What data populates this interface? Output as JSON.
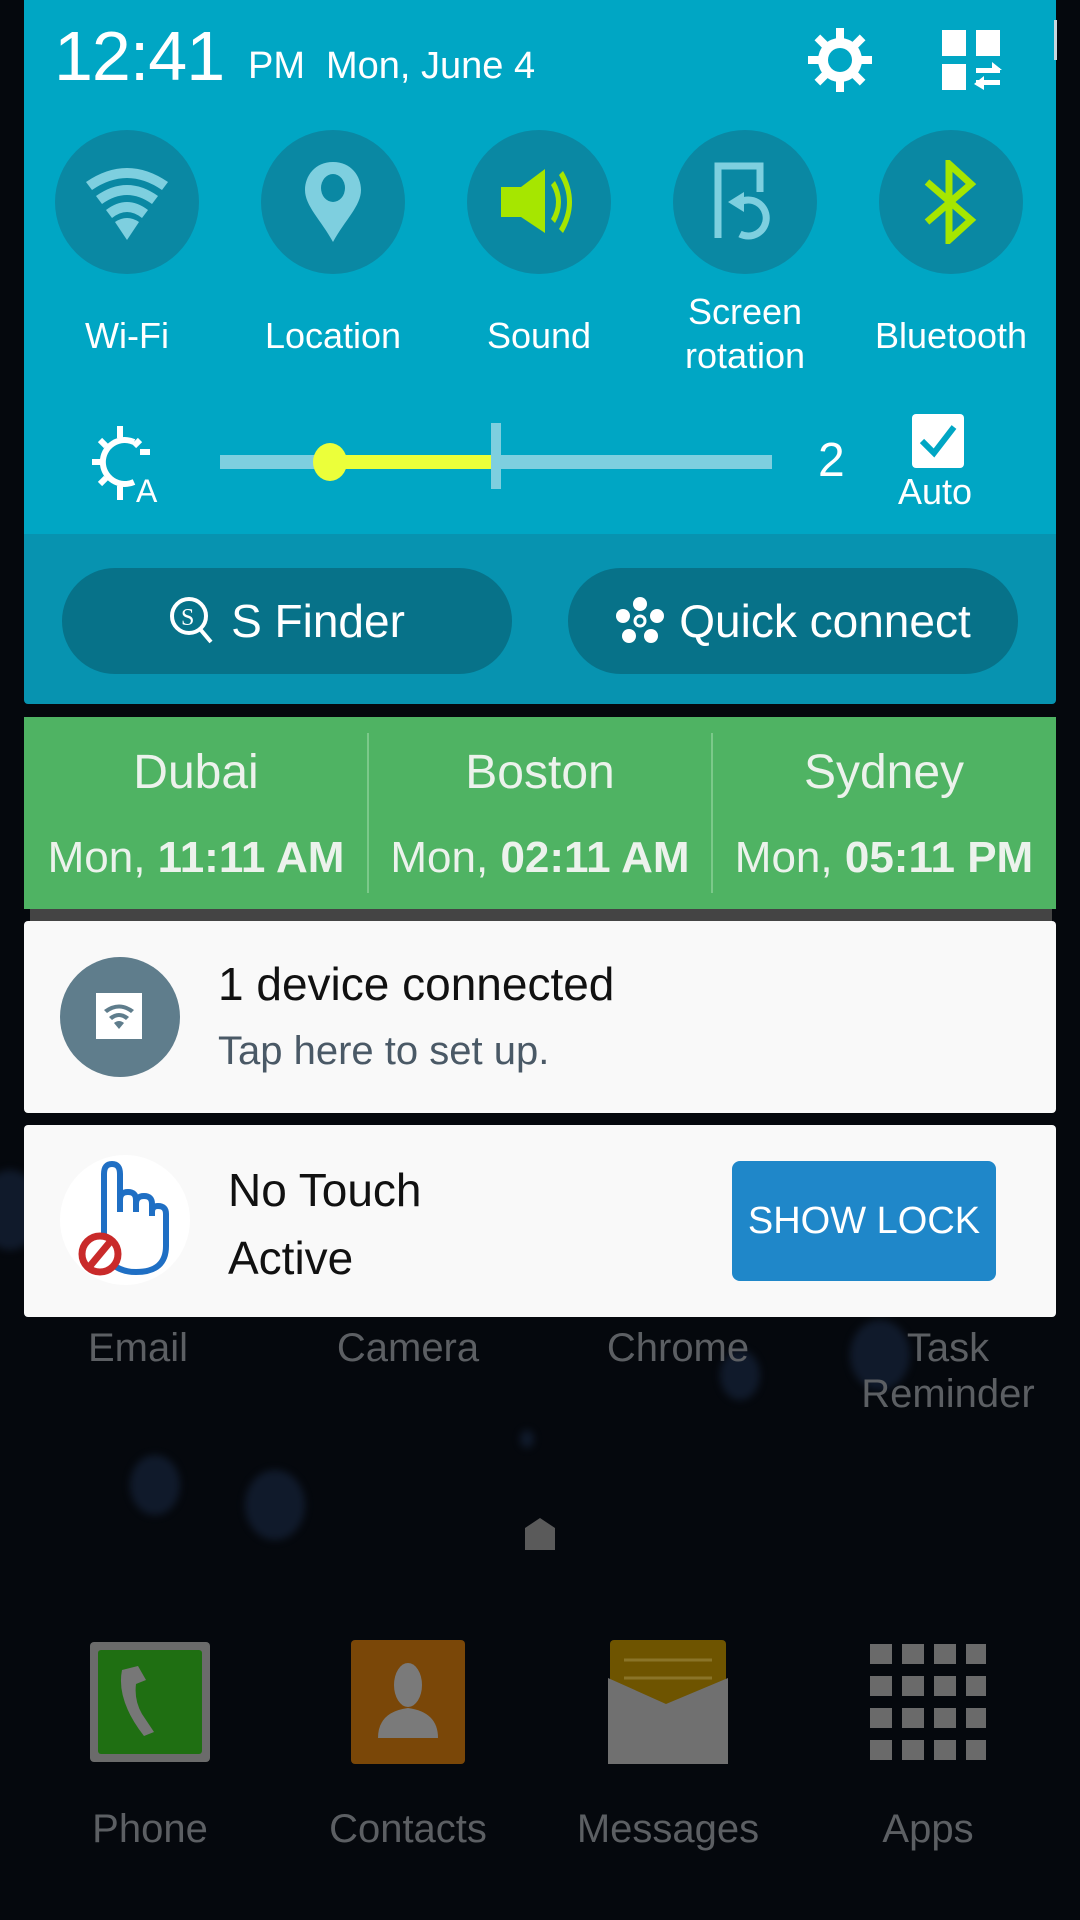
{
  "status": {
    "time": "12:41",
    "ampm": "PM",
    "date": "Mon, June 4"
  },
  "header_icons": {
    "settings": "gear-icon",
    "edit": "quick-panel-edit-icon"
  },
  "toggles": [
    {
      "label": "Wi-Fi",
      "icon": "wifi-icon",
      "active": false
    },
    {
      "label": "Location",
      "icon": "location-pin-icon",
      "active": false
    },
    {
      "label": "Sound",
      "icon": "speaker-icon",
      "active": true
    },
    {
      "label": "Screen rotation",
      "line1": "Screen",
      "line2": "rotation",
      "icon": "screen-rotation-icon",
      "active": false
    },
    {
      "label": "Bluetooth",
      "icon": "bluetooth-icon",
      "active": true
    }
  ],
  "brightness": {
    "icon": "auto-brightness-icon",
    "value": "2",
    "level_fraction": 0.2,
    "auto_level_fraction": 0.5,
    "auto_label": "Auto",
    "auto_checked": true
  },
  "quick_actions": [
    {
      "label": "S Finder",
      "icon": "s-finder-search-icon"
    },
    {
      "label": "Quick connect",
      "icon": "quick-connect-icon"
    }
  ],
  "world_clock": [
    {
      "city": "Dubai",
      "day": "Mon,",
      "time": "11:11 AM"
    },
    {
      "city": "Boston",
      "day": "Mon,",
      "time": "02:11 AM"
    },
    {
      "city": "Sydney",
      "day": "Mon,",
      "time": "05:11 PM"
    }
  ],
  "notifications": [
    {
      "title": "1 device connected",
      "subtitle": "Tap here to set up.",
      "icon": "wifi-device-icon"
    },
    {
      "title": "No Touch",
      "subtitle": "Active",
      "icon": "no-touch-hand-icon",
      "action": "SHOW LOCK"
    }
  ],
  "home_screen": {
    "apps": [
      "Email",
      "Camera",
      "Chrome",
      "Task Reminder"
    ],
    "task_reminder_lines": [
      "Task",
      "Reminder"
    ],
    "dock": [
      {
        "label": "Phone",
        "icon": "phone-icon"
      },
      {
        "label": "Contacts",
        "icon": "contacts-icon"
      },
      {
        "label": "Messages",
        "icon": "messages-icon"
      },
      {
        "label": "Apps",
        "icon": "apps-grid-icon"
      }
    ]
  },
  "colors": {
    "panel": "#00a6c4",
    "toggle_bg": "#0a88a3",
    "toggle_active": "#a6e600",
    "toggle_inactive": "#7ecfdf",
    "slider_fill": "#ebff3a",
    "world_clock_bg": "#4fb363",
    "action_button": "#1f87c9"
  }
}
